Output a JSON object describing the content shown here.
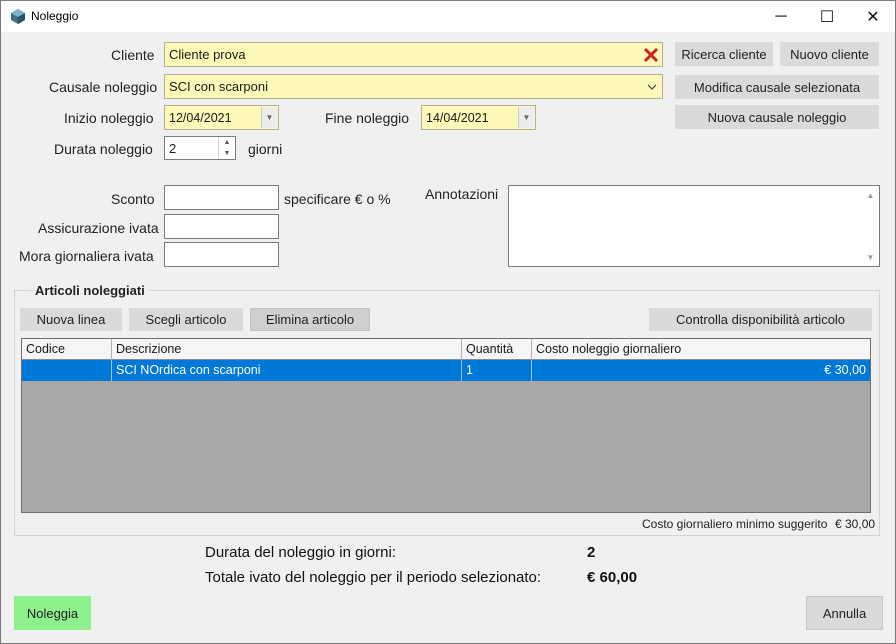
{
  "window": {
    "title": "Noleggio",
    "minimize_glyph": "─",
    "maximize_glyph": "☐",
    "close_glyph": "✕"
  },
  "form": {
    "cliente_label": "Cliente",
    "cliente_value": "Cliente prova",
    "causale_label": "Causale noleggio",
    "causale_value": "SCI con scarponi",
    "inizio_label": "Inizio noleggio",
    "inizio_value": "12/04/2021",
    "fine_label": "Fine noleggio",
    "fine_value": "14/04/2021",
    "durata_label": "Durata noleggio",
    "durata_value": "2",
    "durata_unit": "giorni",
    "sconto_label": "Sconto",
    "sconto_value": "",
    "sconto_hint": "specificare € o %",
    "assicurazione_label": "Assicurazione ivata",
    "assicurazione_value": "",
    "mora_label": "Mora giornaliera ivata",
    "mora_value": "",
    "annotazioni_label": "Annotazioni",
    "annotazioni_value": ""
  },
  "buttons": {
    "ricerca_cliente": "Ricerca cliente",
    "nuovo_cliente": "Nuovo cliente",
    "modifica_causale": "Modifica causale selezionata",
    "nuova_causale": "Nuova causale noleggio",
    "nuova_linea": "Nuova linea",
    "scegli_articolo": "Scegli articolo",
    "elimina_articolo": "Elimina articolo",
    "controlla_disponibilita": "Controlla disponibilità articolo",
    "noleggia": "Noleggia",
    "annulla": "Annulla"
  },
  "articoli": {
    "title": "Articoli noleggiati",
    "columns": [
      "Codice",
      "Descrizione",
      "Quantità",
      "Costo noleggio giornaliero"
    ],
    "rows": [
      {
        "codice": "",
        "descrizione": "SCI NOrdica con scarponi",
        "quantita": "1",
        "costo": "€ 30,00"
      }
    ],
    "costo_minimo_label": "Costo giornaliero minimo suggerito",
    "costo_minimo_value": "€ 30,00"
  },
  "summary": {
    "durata_label": "Durata del noleggio in giorni:",
    "durata_value": "2",
    "totale_label": "Totale ivato del noleggio per il periodo selezionato:",
    "totale_value": "€ 60,00"
  },
  "colors": {
    "selection": "#0078d7",
    "field_highlight": "#fdf7b8",
    "primary_button": "#8cf08c",
    "clear_icon": "#cc2222"
  }
}
